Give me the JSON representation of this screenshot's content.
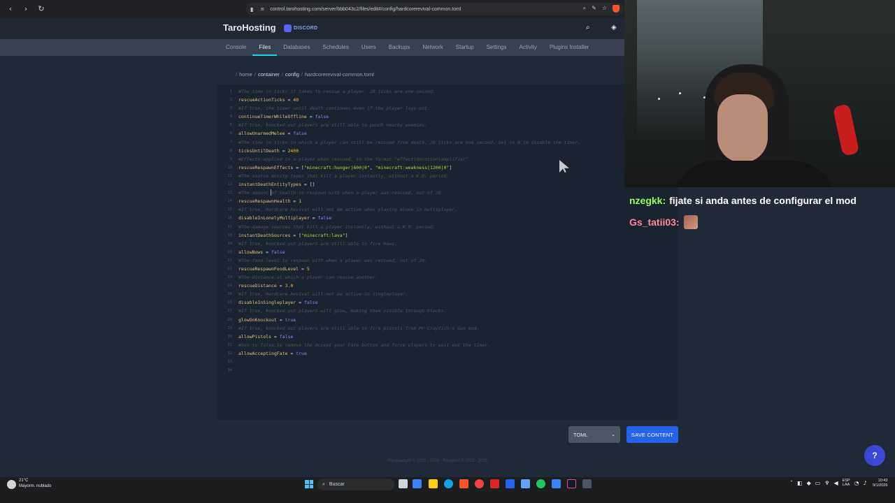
{
  "browser": {
    "url": "control.tarohosting.com/server/bbb043c2/files/edit#/config/hardcorerevival-common.toml"
  },
  "header": {
    "brand": "TaroHosting",
    "discord_label": "DISCORD"
  },
  "tabs": [
    {
      "label": "Console",
      "active": false
    },
    {
      "label": "Files",
      "active": true
    },
    {
      "label": "Databases",
      "active": false
    },
    {
      "label": "Schedules",
      "active": false
    },
    {
      "label": "Users",
      "active": false
    },
    {
      "label": "Backups",
      "active": false
    },
    {
      "label": "Network",
      "active": false
    },
    {
      "label": "Startup",
      "active": false
    },
    {
      "label": "Settings",
      "active": false
    },
    {
      "label": "Activity",
      "active": false
    },
    {
      "label": "Plugins Installer",
      "active": false
    }
  ],
  "breadcrumb": {
    "root": "/",
    "home": "home",
    "container": "container",
    "config": "config",
    "file": "hardcorerevival-common.toml"
  },
  "editor": {
    "lines": [
      {
        "n": "1",
        "parts": [
          {
            "t": "#The time in ticks it takes to rescue a player. 20 ticks are one second.",
            "c": "comment"
          }
        ]
      },
      {
        "n": "2",
        "parts": [
          {
            "t": "rescueActionTicks",
            "c": "key"
          },
          {
            "t": " = ",
            "c": "eq"
          },
          {
            "t": "40",
            "c": "num"
          }
        ]
      },
      {
        "n": "3",
        "parts": [
          {
            "t": "#If true, the timer until death continues even if the player logs out.",
            "c": "comment"
          }
        ]
      },
      {
        "n": "4",
        "parts": [
          {
            "t": "continueTimerWhileOffline",
            "c": "key"
          },
          {
            "t": " = ",
            "c": "eq"
          },
          {
            "t": "false",
            "c": "bool"
          }
        ]
      },
      {
        "n": "5",
        "parts": [
          {
            "t": "#If true, knocked out players are still able to punch nearby enemies.",
            "c": "comment"
          }
        ]
      },
      {
        "n": "6",
        "parts": [
          {
            "t": "allowUnarmedMelee",
            "c": "key"
          },
          {
            "t": " = ",
            "c": "eq"
          },
          {
            "t": "false",
            "c": "bool"
          }
        ]
      },
      {
        "n": "7",
        "parts": [
          {
            "t": "#The time in ticks in which a player can still be rescued from death. 20 ticks are one second. Set to 0 to disable the timer.",
            "c": "comment"
          }
        ]
      },
      {
        "n": "8",
        "parts": [
          {
            "t": "ticksUntilDeath",
            "c": "key"
          },
          {
            "t": " = ",
            "c": "eq"
          },
          {
            "t": "2400",
            "c": "num"
          }
        ]
      },
      {
        "n": "9",
        "parts": [
          {
            "t": "#Effects applied to a player when rescued, in the format \"effect|duration|amplifier\"",
            "c": "comment"
          }
        ]
      },
      {
        "n": "10",
        "parts": [
          {
            "t": "rescueRespawnEffects",
            "c": "key"
          },
          {
            "t": " = [",
            "c": "eq"
          },
          {
            "t": "\"minecraft:hunger|600|0\"",
            "c": "str"
          },
          {
            "t": ", ",
            "c": "eq"
          },
          {
            "t": "\"minecraft:weakness|1200|0\"",
            "c": "str"
          },
          {
            "t": "]",
            "c": "eq"
          }
        ]
      },
      {
        "n": "11",
        "parts": [
          {
            "t": "#The source entity types that kill a player instantly, without a K.O. period.",
            "c": "comment"
          }
        ]
      },
      {
        "n": "12",
        "parts": [
          {
            "t": "instantDeathEntityTypes",
            "c": "key"
          },
          {
            "t": " = []",
            "c": "eq"
          }
        ]
      },
      {
        "n": "13",
        "parts": [
          {
            "t": "#The amount of health to respawn with when a player was rescued, out of 20.",
            "c": "comment"
          }
        ]
      },
      {
        "n": "14",
        "parts": [
          {
            "t": "rescueRespawnHealth",
            "c": "key"
          },
          {
            "t": " = ",
            "c": "eq"
          },
          {
            "t": "1",
            "c": "num"
          }
        ]
      },
      {
        "n": "15",
        "parts": [
          {
            "t": "#If true, Hardcore Revival will not be active when playing alone in multiplayer.",
            "c": "comment"
          }
        ]
      },
      {
        "n": "16",
        "parts": [
          {
            "t": "disableInLonelyMultiplayer",
            "c": "key"
          },
          {
            "t": " = ",
            "c": "eq"
          },
          {
            "t": "false",
            "c": "bool"
          }
        ]
      },
      {
        "n": "17",
        "parts": [
          {
            "t": "#The damage sources that kill a player instantly, without a K.O. period.",
            "c": "comment"
          }
        ]
      },
      {
        "n": "18",
        "parts": [
          {
            "t": "instantDeathSources",
            "c": "key"
          },
          {
            "t": " = [",
            "c": "eq"
          },
          {
            "t": "\"minecraft:lava\"",
            "c": "str"
          },
          {
            "t": "]",
            "c": "eq"
          }
        ]
      },
      {
        "n": "19",
        "parts": [
          {
            "t": "#If true, knocked out players are still able to fire bows.",
            "c": "comment"
          }
        ]
      },
      {
        "n": "20",
        "parts": [
          {
            "t": "allowBows",
            "c": "key"
          },
          {
            "t": " = ",
            "c": "eq"
          },
          {
            "t": "false",
            "c": "bool"
          }
        ]
      },
      {
        "n": "21",
        "parts": [
          {
            "t": "#The food level to respawn with when a player was rescued, out of 20.",
            "c": "comment"
          }
        ]
      },
      {
        "n": "22",
        "parts": [
          {
            "t": "rescueRespawnFoodLevel",
            "c": "key"
          },
          {
            "t": " = ",
            "c": "eq"
          },
          {
            "t": "5",
            "c": "num"
          }
        ]
      },
      {
        "n": "23",
        "parts": [
          {
            "t": "#The distance at which a player can rescue another.",
            "c": "comment"
          }
        ]
      },
      {
        "n": "24",
        "parts": [
          {
            "t": "rescueDistance",
            "c": "key"
          },
          {
            "t": " = ",
            "c": "eq"
          },
          {
            "t": "3.0",
            "c": "num"
          }
        ]
      },
      {
        "n": "25",
        "parts": [
          {
            "t": "#If true, Hardcore Revival will not be active in singleplayer.",
            "c": "comment"
          }
        ]
      },
      {
        "n": "26",
        "parts": [
          {
            "t": "disableInSingleplayer",
            "c": "key"
          },
          {
            "t": " = ",
            "c": "eq"
          },
          {
            "t": "false",
            "c": "bool"
          }
        ]
      },
      {
        "n": "27",
        "parts": [
          {
            "t": "#If true, knocked out players will glow, making them visible through blocks.",
            "c": "comment"
          }
        ]
      },
      {
        "n": "28",
        "parts": [
          {
            "t": "glowOnKnockout",
            "c": "key"
          },
          {
            "t": " = ",
            "c": "eq"
          },
          {
            "t": "true",
            "c": "bool"
          }
        ]
      },
      {
        "n": "29",
        "parts": [
          {
            "t": "#If true, knocked out players are still able to fire pistols from Mr Crayfish's Gun mod.",
            "c": "comment"
          }
        ]
      },
      {
        "n": "30",
        "parts": [
          {
            "t": "allowPistols",
            "c": "key"
          },
          {
            "t": " = ",
            "c": "eq"
          },
          {
            "t": "false",
            "c": "bool"
          }
        ]
      },
      {
        "n": "31",
        "parts": [
          {
            "t": "#Set to false to remove the Accept your Fate button and force players to wait out the timer.",
            "c": "comment"
          }
        ]
      },
      {
        "n": "32",
        "parts": [
          {
            "t": "allowAcceptingFate",
            "c": "key"
          },
          {
            "t": " = ",
            "c": "eq"
          },
          {
            "t": "true",
            "c": "bool"
          }
        ]
      },
      {
        "n": "33",
        "parts": []
      },
      {
        "n": "34",
        "parts": []
      }
    ]
  },
  "controls": {
    "language": "TOML",
    "save_label": "SAVE CONTENT"
  },
  "footer": "Pterodactyl® © 2015 - 2026 · Blueprint © 2023 - 2026",
  "chat": [
    {
      "user": "nzegkk:",
      "message": "fijate si anda antes de configurar el mod"
    },
    {
      "user": "Gs_tatii03:",
      "message": ""
    }
  ],
  "help_label": "?",
  "taskbar": {
    "weather_temp": "21°C",
    "weather_desc": "Mayorm. nublado",
    "search_label": "Buscar",
    "lang_top": "ESP",
    "lang_bottom": "LAA",
    "time": "10:43",
    "date": "9/1/2026"
  }
}
